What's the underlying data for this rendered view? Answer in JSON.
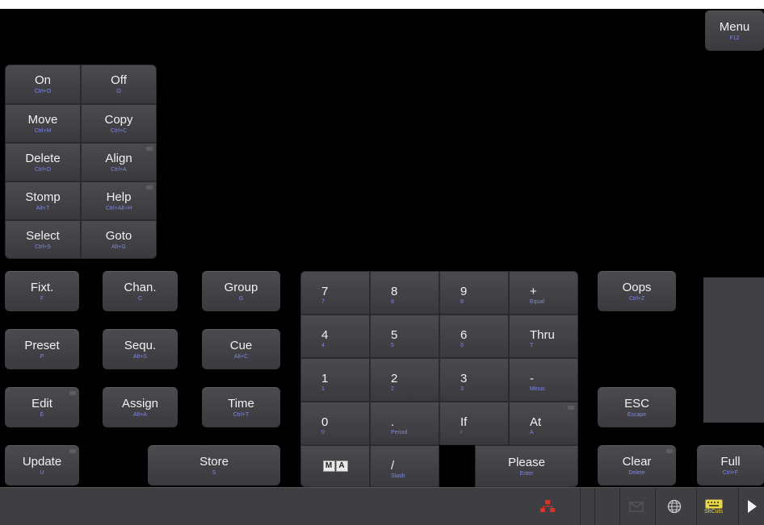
{
  "menu": {
    "label": "Menu",
    "shortcut": "F12"
  },
  "command_grid": [
    {
      "label": "On",
      "shortcut": "Ctrl+O"
    },
    {
      "label": "Off",
      "shortcut": "O"
    },
    {
      "label": "Move",
      "shortcut": "Ctrl+M"
    },
    {
      "label": "Copy",
      "shortcut": "Ctrl+C"
    },
    {
      "label": "Delete",
      "shortcut": "Ctrl+D"
    },
    {
      "label": "Align",
      "shortcut": "Ctrl+A"
    },
    {
      "label": "Stomp",
      "shortcut": "Alt+T"
    },
    {
      "label": "Help",
      "shortcut": "Ctrl+Alt+H"
    },
    {
      "label": "Select",
      "shortcut": "Ctrl+S"
    },
    {
      "label": "Goto",
      "shortcut": "Alt+G"
    }
  ],
  "pool_keys": [
    {
      "label": "Fixt.",
      "shortcut": "F"
    },
    {
      "label": "Chan.",
      "shortcut": "C"
    },
    {
      "label": "Group",
      "shortcut": "G"
    },
    {
      "label": "Preset",
      "shortcut": "P"
    },
    {
      "label": "Sequ.",
      "shortcut": "Alt+S"
    },
    {
      "label": "Cue",
      "shortcut": "Alt+C"
    },
    {
      "label": "Edit",
      "shortcut": "E"
    },
    {
      "label": "Assign",
      "shortcut": "Alt+A"
    },
    {
      "label": "Time",
      "shortcut": "Ctrl+T"
    },
    {
      "label": "Update",
      "shortcut": "U"
    },
    {
      "label": "Store",
      "shortcut": "S"
    }
  ],
  "numpad": [
    {
      "label": "7",
      "shortcut": "7"
    },
    {
      "label": "8",
      "shortcut": "8"
    },
    {
      "label": "9",
      "shortcut": "9"
    },
    {
      "label": "+",
      "shortcut": "Equal"
    },
    {
      "label": "4",
      "shortcut": "4"
    },
    {
      "label": "5",
      "shortcut": "5"
    },
    {
      "label": "6",
      "shortcut": "6"
    },
    {
      "label": "Thru",
      "shortcut": "T"
    },
    {
      "label": "1",
      "shortcut": "1"
    },
    {
      "label": "2",
      "shortcut": "2"
    },
    {
      "label": "3",
      "shortcut": "3"
    },
    {
      "label": "-",
      "shortcut": "Minus"
    },
    {
      "label": "0",
      "shortcut": "0"
    },
    {
      "label": ".",
      "shortcut": "Period"
    },
    {
      "label": "If",
      "shortcut": "I"
    },
    {
      "label": "At",
      "shortcut": "A"
    },
    {
      "label": "/",
      "shortcut": "Slash"
    },
    {
      "label": "Please",
      "shortcut": "Enter"
    }
  ],
  "ma_key": {
    "m": "M",
    "a": "A"
  },
  "right_keys": [
    {
      "label": "Oops",
      "shortcut": "Ctrl+Z"
    },
    {
      "label": "ESC",
      "shortcut": "Escape"
    },
    {
      "label": "Clear",
      "shortcut": "Delete"
    },
    {
      "label": "Full",
      "shortcut": "Ctrl+F"
    }
  ],
  "statusbar": {
    "shortcuts_label": "ShCuts"
  }
}
